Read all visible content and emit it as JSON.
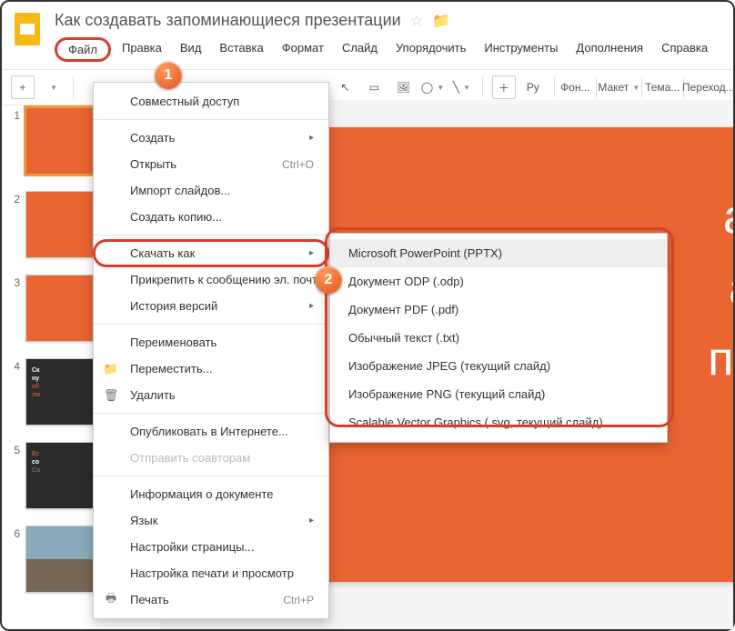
{
  "doc_title": "Как создавать запоминающиеся презентации",
  "menubar": {
    "file": "Файл",
    "edit": "Правка",
    "view": "Вид",
    "insert": "Вставка",
    "format": "Формат",
    "slide": "Слайд",
    "arrange": "Упорядочить",
    "tools": "Инструменты",
    "addons": "Дополнения",
    "help": "Справка"
  },
  "toolbar": {
    "ru": "Ру",
    "font": "Фон...",
    "layout": "Макет",
    "theme": "Тема...",
    "transition": "Переход..."
  },
  "file_menu": {
    "share": "Совместный доступ",
    "new": "Создать",
    "open": "Открыть",
    "open_sc": "Ctrl+O",
    "import": "Импорт слайдов...",
    "copy": "Создать копию...",
    "download": "Скачать как",
    "attach": "Прикрепить к сообщению эл. почты",
    "history": "История версий",
    "rename": "Переименовать",
    "move": "Переместить...",
    "delete": "Удалить",
    "publish": "Опубликовать в Интернете...",
    "sendco": "Отправить соавторам",
    "docinfo": "Информация о документе",
    "lang": "Язык",
    "pagesetup": "Настройки страницы...",
    "printsetup": "Настройка печати и просмотр",
    "print": "Печать",
    "print_sc": "Ctrl+P"
  },
  "submenu": {
    "pptx": "Microsoft PowerPoint (PPTX)",
    "odp": "Документ ODP (.odp)",
    "pdf": "Документ PDF (.pdf)",
    "txt": "Обычный текст (.txt)",
    "jpeg": "Изображение JPEG (текущий слайд)",
    "png": "Изображение PNG (текущий слайд)",
    "svg": "Scalable Vector Graphics (.svg, текущий слайд)"
  },
  "badges": {
    "one": "1",
    "two": "2"
  },
  "thumbs": [
    "1",
    "2",
    "3",
    "4",
    "5",
    "6"
  ],
  "slide_text_1": "ак с",
  "slide_text_2": "апо",
  "slide_text_3": "през"
}
